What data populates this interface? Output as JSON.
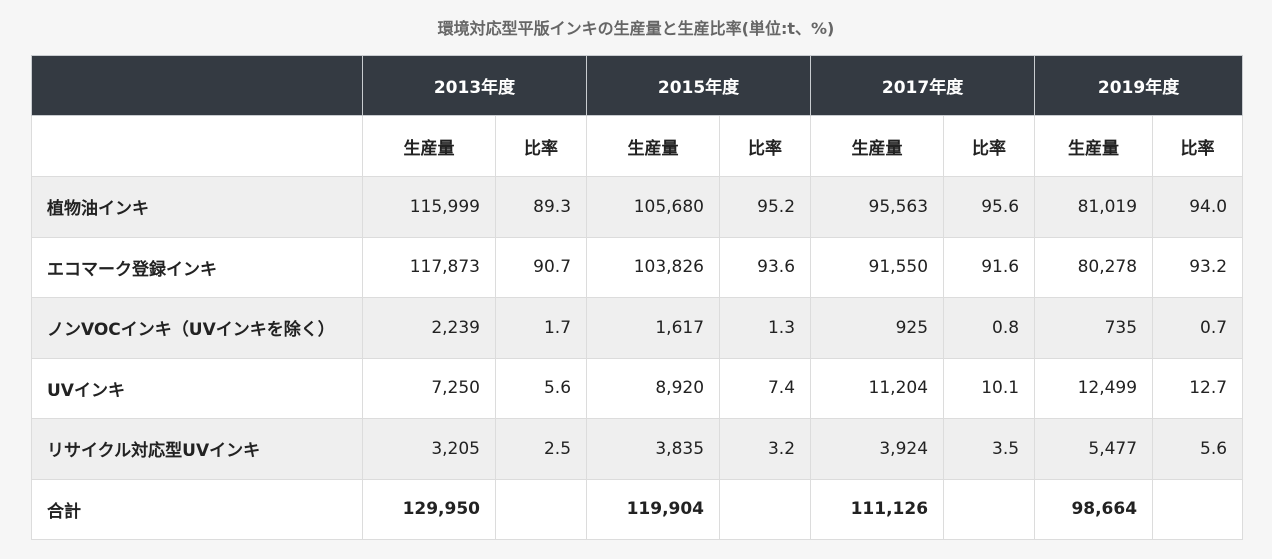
{
  "caption": "環境対応型平版インキの生産量と生産比率(単位:t、%)",
  "years": [
    "2013年度",
    "2015年度",
    "2017年度",
    "2019年度"
  ],
  "sub_headers": {
    "production": "生産量",
    "ratio": "比率"
  },
  "rows": [
    {
      "label": "植物油インキ",
      "cells": [
        "115,999",
        "89.3",
        "105,680",
        "95.2",
        "95,563",
        "95.6",
        "81,019",
        "94.0"
      ]
    },
    {
      "label": "エコマーク登録インキ",
      "cells": [
        "117,873",
        "90.7",
        "103,826",
        "93.6",
        "91,550",
        "91.6",
        "80,278",
        "93.2"
      ]
    },
    {
      "label": "ノンVOCインキ（UVインキを除く）",
      "cells": [
        "2,239",
        "1.7",
        "1,617",
        "1.3",
        "925",
        "0.8",
        "735",
        "0.7"
      ]
    },
    {
      "label": "UVインキ",
      "cells": [
        "7,250",
        "5.6",
        "8,920",
        "7.4",
        "11,204",
        "10.1",
        "12,499",
        "12.7"
      ]
    },
    {
      "label": "リサイクル対応型UVインキ",
      "cells": [
        "3,205",
        "2.5",
        "3,835",
        "3.2",
        "3,924",
        "3.5",
        "5,477",
        "5.6"
      ]
    },
    {
      "label": "合計",
      "cells": [
        "129,950",
        "",
        "119,904",
        "",
        "111,126",
        "",
        "98,664",
        ""
      ]
    }
  ]
}
